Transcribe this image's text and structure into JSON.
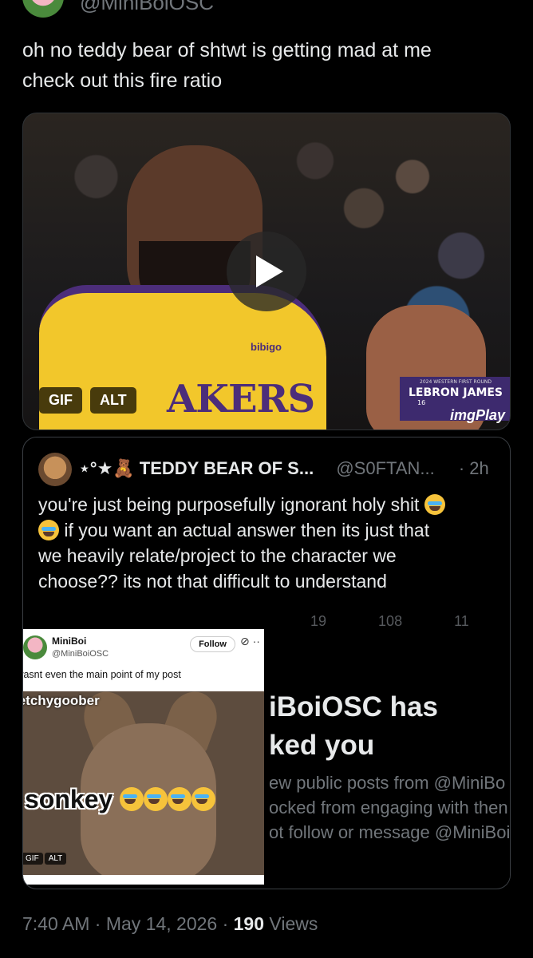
{
  "author": {
    "handle": "@MiniBoiOSC"
  },
  "tweet": {
    "line1": "oh no teddy bear of shtwt is getting mad at me",
    "line2": "check out this fire ratio"
  },
  "media": {
    "gif_badge": "GIF",
    "alt_badge": "ALT",
    "jersey_text": "AKERS",
    "jersey_sponsor": "bibigo",
    "overlay_small": "2024 WESTERN FIRST ROUND",
    "overlay_name": "LEBRON JAMES",
    "overlay_num": "16",
    "watermark": "imgPlay"
  },
  "quote": {
    "name": "⋆°★🧸 TEDDY BEAR OF S...",
    "handle": "@S0FTAN...",
    "time": "· 2h",
    "text_1": "you're just being purposefully ignorant holy shit",
    "text_2": "if you want an actual answer then its just that",
    "text_3": "we heavily relate/project to the character we",
    "text_4": "choose?? its not that difficult to understand",
    "ghost_replies": "19",
    "ghost_likes": "108",
    "ghost_views": "11"
  },
  "screenshot": {
    "name": "MiniBoi",
    "handle": "@MiniBoiOSC",
    "follow": "Follow",
    "text": "his wasnt even the main point of my post",
    "gif_caption": "stretchygoober",
    "sonkey": "sonkey",
    "gif_label": "GIF",
    "alt_label": "ALT"
  },
  "blocked": {
    "title_1": "iBoiOSC has",
    "title_2": "ked you",
    "body_1": "ew public posts from @MiniBo",
    "body_2": "ocked from engaging with then",
    "body_3": "ot follow or message @MiniBoi"
  },
  "footer": {
    "time": "7:40 AM · May 14, 2026 · ",
    "views_count": "190",
    "views_label": " Views"
  }
}
